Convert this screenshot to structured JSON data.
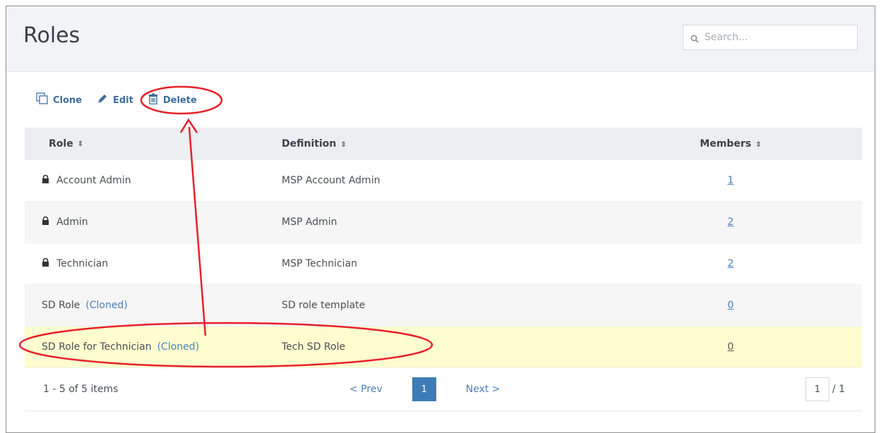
{
  "page": {
    "title": "Roles"
  },
  "search": {
    "placeholder": "Search..."
  },
  "toolbar": {
    "clone_label": "Clone",
    "edit_label": "Edit",
    "delete_label": "Delete"
  },
  "table": {
    "headers": {
      "role": "Role",
      "definition": "Definition",
      "members": "Members",
      "sort_glyph": "⇕"
    },
    "rows": [
      {
        "role": "Account Admin",
        "locked": true,
        "cloned_tag": "",
        "definition": "MSP Account Admin",
        "members": "1"
      },
      {
        "role": "Admin",
        "locked": true,
        "cloned_tag": "",
        "definition": "MSP Admin",
        "members": "2"
      },
      {
        "role": "Technician",
        "locked": true,
        "cloned_tag": "",
        "definition": "MSP Technician",
        "members": "2"
      },
      {
        "role": "SD Role",
        "locked": false,
        "cloned_tag": "(Cloned)",
        "definition": "SD role template",
        "members": "0"
      },
      {
        "role": "SD Role for Technician",
        "locked": false,
        "cloned_tag": "(Cloned)",
        "definition": "Tech SD Role",
        "members": "0"
      }
    ]
  },
  "pager": {
    "summary": "1 - 5 of 5 items",
    "prev_label": "< Prev",
    "current_page": "1",
    "next_label": "Next >",
    "goto_value": "1",
    "total_pages_label": "/ 1"
  },
  "colors": {
    "accent": "#3d7cb6",
    "link": "#4a82bd",
    "highlight_row": "#fdfdcf",
    "annotation": "#e8202a"
  },
  "icons": {
    "search": "search-icon",
    "clone": "clone-icon",
    "edit": "pencil-icon",
    "delete": "trash-icon",
    "lock": "lock-icon"
  }
}
